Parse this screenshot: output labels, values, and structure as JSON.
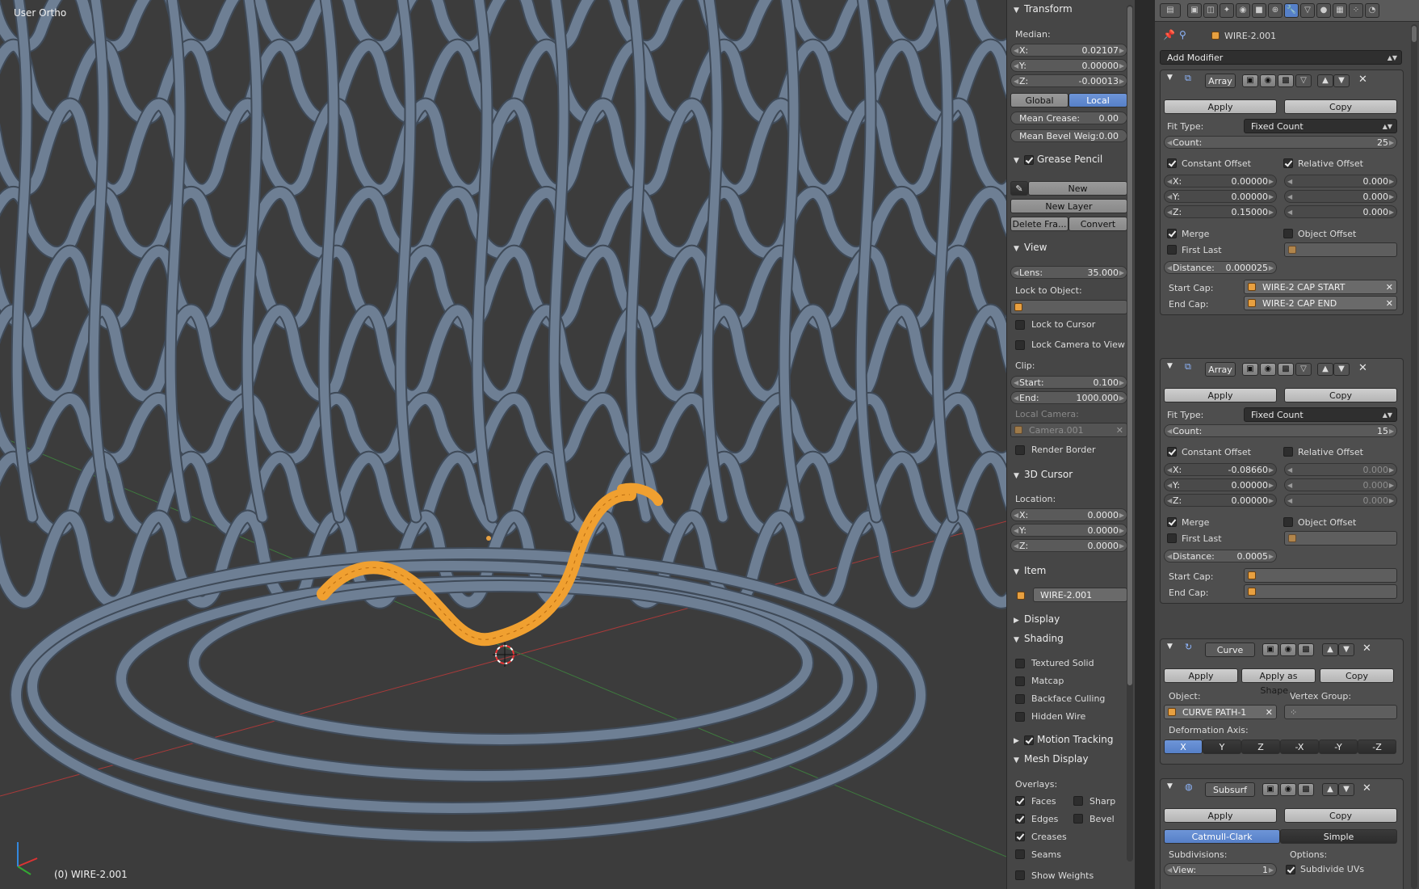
{
  "viewport": {
    "view_label": "User Ortho",
    "status_object": "(0) WIRE-2.001",
    "colors": {
      "mesh": "#6e7f94",
      "mesh_shadow": "#3f4a58",
      "selection": "#f0a030",
      "axis_x": "#a83a3a",
      "axis_y": "#3e7a3e"
    }
  },
  "npanel": {
    "transform": {
      "header": "Transform",
      "median_label": "Median:",
      "x": {
        "key": "X:",
        "value": "0.02107"
      },
      "y": {
        "key": "Y:",
        "value": "0.00000"
      },
      "z": {
        "key": "Z:",
        "value": "-0.00013"
      },
      "global_label": "Global",
      "local_label": "Local",
      "mean_crease": {
        "key": "Mean Crease:",
        "value": "0.00"
      },
      "mean_bevel": {
        "key": "Mean Bevel Weig:",
        "value": "0.00"
      }
    },
    "grease_pencil": {
      "header": "Grease Pencil",
      "new_label": "New",
      "new_layer_label": "New Layer",
      "delete_frame_label": "Delete Fra...",
      "convert_label": "Convert"
    },
    "view": {
      "header": "View",
      "lens": {
        "key": "Lens:",
        "value": "35.000"
      },
      "lock_to_object_label": "Lock to Object:",
      "lock_to_cursor_label": "Lock to Cursor",
      "lock_camera_label": "Lock Camera to View",
      "clip_label": "Clip:",
      "clip_start": {
        "key": "Start:",
        "value": "0.100"
      },
      "clip_end": {
        "key": "End:",
        "value": "1000.000"
      },
      "local_camera_label": "Local Camera:",
      "local_camera_value": "Camera.001",
      "render_border_label": "Render Border"
    },
    "cursor": {
      "header": "3D Cursor",
      "location_label": "Location:",
      "x": {
        "key": "X:",
        "value": "0.0000"
      },
      "y": {
        "key": "Y:",
        "value": "0.0000"
      },
      "z": {
        "key": "Z:",
        "value": "0.0000"
      }
    },
    "item": {
      "header": "Item",
      "name": "WIRE-2.001"
    },
    "display": {
      "header": "Display"
    },
    "shading": {
      "header": "Shading",
      "textured_solid": "Textured Solid",
      "matcap": "Matcap",
      "backface_culling": "Backface Culling",
      "hidden_wire": "Hidden Wire"
    },
    "motion_tracking": {
      "header": "Motion Tracking"
    },
    "mesh_display": {
      "header": "Mesh Display",
      "overlays_label": "Overlays:",
      "faces": "Faces",
      "sharp": "Sharp",
      "edges": "Edges",
      "bevel": "Bevel",
      "creases": "Creases",
      "seams": "Seams",
      "show_weights": "Show Weights"
    }
  },
  "properties": {
    "object_name": "WIRE-2.001",
    "add_modifier_label": "Add Modifier",
    "modifiers": [
      {
        "name": "Array",
        "apply": "Apply",
        "copy": "Copy",
        "fit_type_label": "Fit Type:",
        "fit_type_value": "Fixed Count",
        "count": {
          "key": "Count:",
          "value": "25"
        },
        "constant_offset": "Constant Offset",
        "relative_offset": "Relative Offset",
        "cx": {
          "key": "X:",
          "value": "0.00000"
        },
        "cy": {
          "key": "Y:",
          "value": "0.00000"
        },
        "cz": {
          "key": "Z:",
          "value": "0.15000"
        },
        "rx": "0.000",
        "ry": "0.000",
        "rz": "0.000",
        "merge": "Merge",
        "object_offset": "Object Offset",
        "first_last": "First Last",
        "distance": {
          "key": "Distance:",
          "value": "0.000025"
        },
        "start_cap_label": "Start Cap:",
        "start_cap_value": "WIRE-2 CAP START",
        "end_cap_label": "End Cap:",
        "end_cap_value": "WIRE-2 CAP END"
      },
      {
        "name": "Array",
        "apply": "Apply",
        "copy": "Copy",
        "fit_type_label": "Fit Type:",
        "fit_type_value": "Fixed Count",
        "count": {
          "key": "Count:",
          "value": "15"
        },
        "constant_offset": "Constant Offset",
        "relative_offset": "Relative Offset",
        "cx": {
          "key": "X:",
          "value": "-0.08660"
        },
        "cy": {
          "key": "Y:",
          "value": "0.00000"
        },
        "cz": {
          "key": "Z:",
          "value": "0.00000"
        },
        "rx": "0.000",
        "ry": "0.000",
        "rz": "0.000",
        "merge": "Merge",
        "object_offset": "Object Offset",
        "first_last": "First Last",
        "distance": {
          "key": "Distance:",
          "value": "0.0005"
        },
        "start_cap_label": "Start Cap:",
        "end_cap_label": "End Cap:"
      },
      {
        "name": "Curve",
        "apply": "Apply",
        "apply_shape": "Apply as Shape...",
        "copy": "Copy",
        "object_label": "Object:",
        "object_value": "CURVE PATH-1",
        "vertex_group_label": "Vertex Group:",
        "deformation_axis_label": "Deformation Axis:",
        "axes": [
          "X",
          "Y",
          "Z",
          "-X",
          "-Y",
          "-Z"
        ]
      },
      {
        "name": "Subsurf",
        "apply": "Apply",
        "copy": "Copy",
        "catmull": "Catmull-Clark",
        "simple": "Simple",
        "subdivisions_label": "Subdivisions:",
        "options_label": "Options:",
        "view": {
          "key": "View:",
          "value": "1"
        },
        "subdivide_uvs": "Subdivide UVs"
      }
    ]
  }
}
